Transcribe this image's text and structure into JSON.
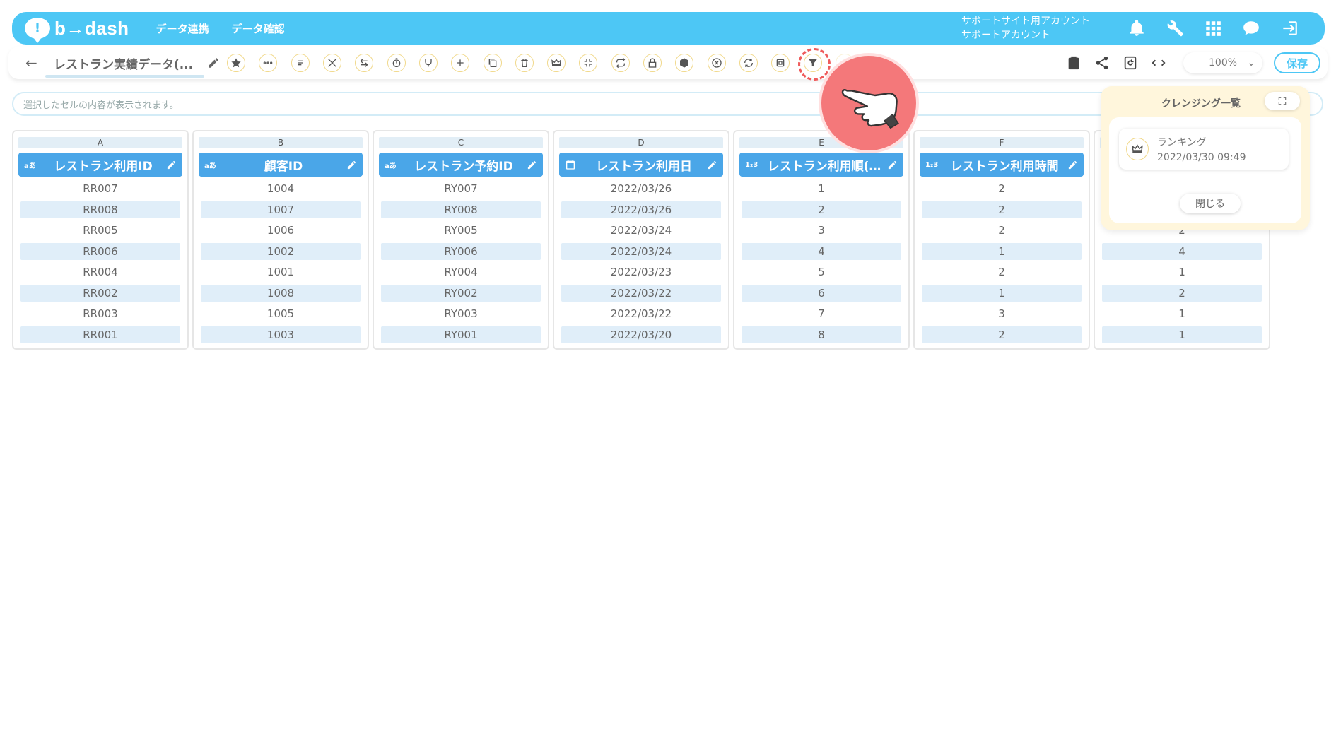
{
  "header": {
    "logo_text": "b→dash",
    "nav": [
      "データ連携",
      "データ確認"
    ],
    "account_line1": "サポートサイト用アカウント",
    "account_line2": "サポートアカウント",
    "icons": [
      "bell-icon",
      "wrench-icon",
      "grid-icon",
      "chat-icon",
      "logout-icon"
    ]
  },
  "toolbar": {
    "back": "←",
    "title": "レストラン実績データ(...",
    "tools": [
      "star-icon",
      "dots-icon",
      "list-icon",
      "tools-icon",
      "sort-icon",
      "timer-icon",
      "branch-icon",
      "plus-icon",
      "copy-icon",
      "trash-icon",
      "crown-icon",
      "compress-icon",
      "repeat-icon",
      "lock-icon",
      "box-icon",
      "close-circle-icon",
      "swap-icon",
      "square-icon",
      "filter-icon",
      "extra-icon"
    ],
    "right_icons": [
      "clipboard-icon",
      "share-icon",
      "refresh-icon",
      "code-icon"
    ],
    "zoom": "100%",
    "save_label": "保存"
  },
  "cellbar": {
    "placeholder": "選択したセルの内容が表示されます。"
  },
  "columns": [
    {
      "letter": "A",
      "type": "aあ",
      "label": "レストラン利用ID",
      "rows": [
        "RR007",
        "RR008",
        "RR005",
        "RR006",
        "RR004",
        "RR002",
        "RR003",
        "RR001"
      ]
    },
    {
      "letter": "B",
      "type": "aあ",
      "label": "顧客ID",
      "rows": [
        "1004",
        "1007",
        "1006",
        "1002",
        "1001",
        "1008",
        "1005",
        "1003"
      ]
    },
    {
      "letter": "C",
      "type": "aあ",
      "label": "レストラン予約ID",
      "rows": [
        "RY007",
        "RY008",
        "RY005",
        "RY006",
        "RY004",
        "RY002",
        "RY003",
        "RY001"
      ]
    },
    {
      "letter": "D",
      "type": "date",
      "label": "レストラン利用日",
      "rows": [
        "2022/03/26",
        "2022/03/26",
        "2022/03/24",
        "2022/03/24",
        "2022/03/23",
        "2022/03/22",
        "2022/03/22",
        "2022/03/20"
      ]
    },
    {
      "letter": "E",
      "type": "1₂3",
      "label": "レストラン利用順(…",
      "rows": [
        "1",
        "2",
        "3",
        "4",
        "5",
        "6",
        "7",
        "8"
      ]
    },
    {
      "letter": "F",
      "type": "1₂3",
      "label": "レストラン利用時間",
      "rows": [
        "2",
        "2",
        "2",
        "1",
        "2",
        "1",
        "3",
        "2"
      ]
    },
    {
      "letter": "",
      "type": "",
      "label": "",
      "rows": [
        "2",
        "4",
        "1",
        "2",
        "1",
        "1"
      ]
    }
  ],
  "panel": {
    "title": "クレンジング一覧",
    "card_name": "ランキング",
    "card_time": "2022/03/30 09:49",
    "close_label": "閉じる"
  },
  "colors": {
    "header": "#4dc7f5",
    "column_header": "#4aa6e8",
    "row_stripe": "#e0eef9",
    "panel_bg": "#fff6dc",
    "pointer": "#f4787a"
  }
}
